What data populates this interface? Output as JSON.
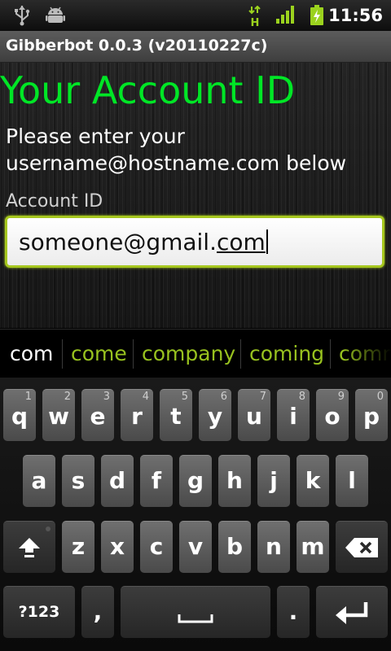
{
  "status_bar": {
    "time": "11:56",
    "icons": [
      "usb-icon",
      "android-debug-icon",
      "hplus-network-icon",
      "signal-icon",
      "battery-charging-icon"
    ],
    "network_type": "H"
  },
  "app": {
    "title": "Gibberbot 0.0.3 (v20110227c)"
  },
  "screen": {
    "heading": "Your Account ID",
    "instructions": "Please enter your username@hostname.com below",
    "field_label": "Account ID",
    "input_value_prefix": "someone@gmail.",
    "input_value_composing": "com"
  },
  "suggestions": [
    "com",
    "come",
    "company",
    "coming",
    "comm"
  ],
  "keyboard": {
    "row1": [
      {
        "l": "q",
        "n": "1"
      },
      {
        "l": "w",
        "n": "2"
      },
      {
        "l": "e",
        "n": "3"
      },
      {
        "l": "r",
        "n": "4"
      },
      {
        "l": "t",
        "n": "5"
      },
      {
        "l": "y",
        "n": "6"
      },
      {
        "l": "u",
        "n": "7"
      },
      {
        "l": "i",
        "n": "8"
      },
      {
        "l": "o",
        "n": "9"
      },
      {
        "l": "p",
        "n": "0"
      }
    ],
    "row2": [
      "a",
      "s",
      "d",
      "f",
      "g",
      "h",
      "j",
      "k",
      "l"
    ],
    "row3": [
      "z",
      "x",
      "c",
      "v",
      "b",
      "n",
      "m"
    ],
    "symbols_label": "?123",
    "comma_label": ",",
    "period_label": ".",
    "icons": [
      "shift-icon",
      "delete-icon",
      "space-icon",
      "enter-icon"
    ]
  },
  "colors": {
    "heading": "#00e626",
    "accent": "#a6c71e",
    "suggestion": "#98c21f"
  }
}
